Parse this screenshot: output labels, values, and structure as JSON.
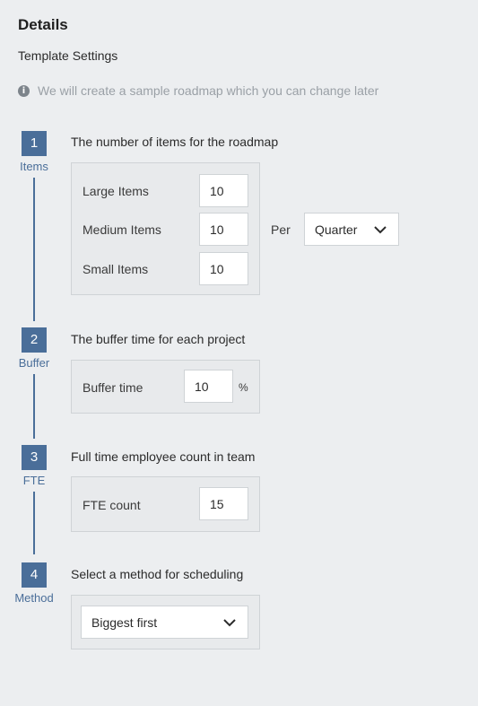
{
  "header": {
    "title": "Details",
    "subtitle": "Template Settings",
    "info_text": "We will create a sample roadmap which you can change later",
    "info_icon": "info-icon"
  },
  "steps": [
    {
      "number": "1",
      "label": "Items",
      "heading": "The number of items for the roadmap",
      "fields": [
        {
          "label": "Large Items",
          "value": "10"
        },
        {
          "label": "Medium Items",
          "value": "10"
        },
        {
          "label": "Small Items",
          "value": "10"
        }
      ],
      "per_label": "Per",
      "per_select": "Quarter"
    },
    {
      "number": "2",
      "label": "Buffer",
      "heading": "The buffer time for each project",
      "field_label": "Buffer time",
      "value": "10",
      "unit": "%"
    },
    {
      "number": "3",
      "label": "FTE",
      "heading": "Full time employee count in team",
      "field_label": "FTE count",
      "value": "15"
    },
    {
      "number": "4",
      "label": "Method",
      "heading": "Select a method for scheduling",
      "select": "Biggest first"
    }
  ],
  "colors": {
    "accent": "#4a6e99",
    "background": "#eceef0",
    "panel_border": "#cfd3d6"
  }
}
